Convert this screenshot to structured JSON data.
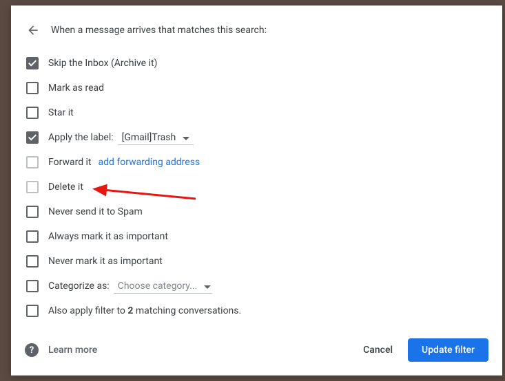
{
  "header": {
    "title": "When a message arrives that matches this search:"
  },
  "options": {
    "skip_inbox": "Skip the Inbox (Archive it)",
    "mark_read": "Mark as read",
    "star": "Star it",
    "apply_label_prefix": "Apply the label:",
    "apply_label_value": "[Gmail]Trash",
    "forward": "Forward it",
    "forward_link": "add forwarding address",
    "delete": "Delete it",
    "never_spam": "Never send it to Spam",
    "always_important": "Always mark it as important",
    "never_important": "Never mark it as important",
    "categorize_prefix": "Categorize as:",
    "categorize_value": "Choose category...",
    "also_apply_pre": "Also apply filter to ",
    "also_apply_count": "2",
    "also_apply_post": " matching conversations."
  },
  "footer": {
    "learn_more": "Learn more",
    "cancel": "Cancel",
    "update": "Update filter"
  }
}
